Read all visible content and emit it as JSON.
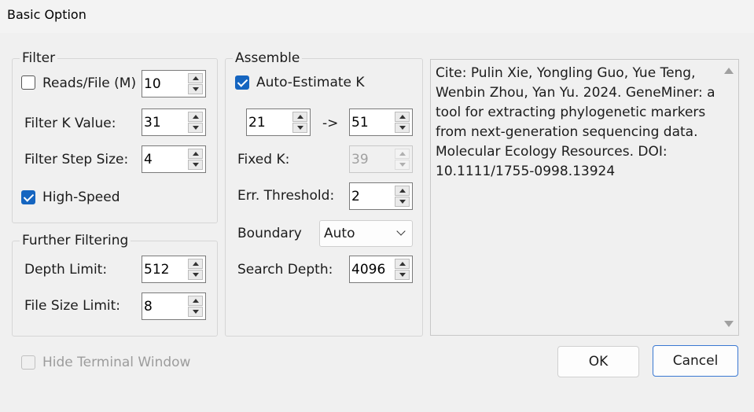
{
  "window": {
    "title": "Basic Option"
  },
  "filter": {
    "group_label": "Filter",
    "reads_file": {
      "label": "Reads/File (M)",
      "checked": false,
      "value": "10"
    },
    "filter_k_value": {
      "label": "Filter K Value:",
      "value": "31"
    },
    "filter_step_size": {
      "label": "Filter Step Size:",
      "value": "4"
    },
    "high_speed": {
      "label": "High-Speed",
      "checked": true
    }
  },
  "further_filtering": {
    "group_label": "Further Filtering",
    "depth_limit": {
      "label": "Depth Limit:",
      "value": "512"
    },
    "file_size_limit": {
      "label": "File Size Limit:",
      "value": "8"
    }
  },
  "assemble": {
    "group_label": "Assemble",
    "auto_estimate_k": {
      "label": "Auto-Estimate K",
      "checked": true
    },
    "k_range": {
      "from": "21",
      "arrow": "->",
      "to": "51"
    },
    "fixed_k": {
      "label": "Fixed K:",
      "value": "39",
      "disabled": true
    },
    "err_threshold": {
      "label": "Err. Threshold:",
      "value": "2"
    },
    "boundary": {
      "label": "Boundary",
      "selected": "Auto"
    },
    "search_depth": {
      "label": "Search Depth:",
      "value": "4096"
    }
  },
  "citation": {
    "text": "Cite: Pulin Xie, Yongling Guo, Yue Teng, Wenbin Zhou, Yan Yu. 2024. GeneMiner: a tool for extracting phylogenetic markers from next-generation sequencing data. Molecular Ecology Resources. DOI: 10.1111/1755-0998.13924"
  },
  "hide_terminal": {
    "label": "Hide Terminal Window",
    "checked": false,
    "disabled": true
  },
  "buttons": {
    "ok": "OK",
    "cancel": "Cancel"
  },
  "colors": {
    "accent": "#1565c0",
    "default_button_border": "#3a78d2",
    "background": "#f0f0f0"
  }
}
